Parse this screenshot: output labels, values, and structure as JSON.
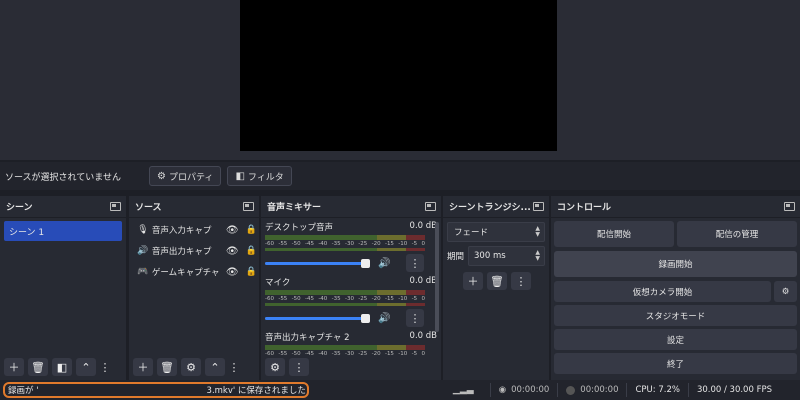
{
  "context_bar": {
    "message": "ソースが選択されていません",
    "properties_label": "プロパティ",
    "filters_label": "フィルタ"
  },
  "docks": {
    "scenes": {
      "title": "シーン",
      "items": [
        "シーン 1"
      ]
    },
    "sources": {
      "title": "ソース",
      "items": [
        {
          "name": "音声入力キャプ",
          "icon": "microphone-icon"
        },
        {
          "name": "音声出力キャプ",
          "icon": "speaker-icon"
        },
        {
          "name": "ゲームキャプチャ",
          "icon": "gamepad-icon"
        }
      ]
    },
    "mixer": {
      "title": "音声ミキサー",
      "channels": [
        {
          "name": "デスクトップ音声",
          "db": "0.0 dB",
          "volume": 1.0
        },
        {
          "name": "マイク",
          "db": "0.0 dB",
          "volume": 1.0
        },
        {
          "name": "音声出力キャプチャ 2",
          "db": "0.0 dB",
          "volume": 1.0
        }
      ],
      "scale": [
        "-60",
        "-55",
        "-50",
        "-45",
        "-40",
        "-35",
        "-30",
        "-25",
        "-20",
        "-15",
        "-10",
        "-5",
        "0"
      ]
    },
    "transitions": {
      "title": "シーントランジシ...",
      "selected": "フェード",
      "duration_label": "期間",
      "duration_value": "300 ms"
    },
    "controls": {
      "title": "コントロール",
      "start_streaming": "配信開始",
      "manage_broadcast": "配信の管理",
      "start_recording": "録画開始",
      "start_virtual_camera": "仮想カメラ開始",
      "studio_mode": "スタジオモード",
      "settings": "設定",
      "exit": "終了"
    }
  },
  "status_bar": {
    "message_prefix": "録画が '",
    "message_suffix": "3.mkv' に保存されました",
    "stream_time": "00:00:00",
    "record_time": "00:00:00",
    "cpu": "CPU: 7.2%",
    "fps": "30.00 / 30.00 FPS"
  },
  "colors": {
    "accent": "#284cb8",
    "highlight_outline": "#e07a2c",
    "volume_fill": "#3b82f6"
  }
}
